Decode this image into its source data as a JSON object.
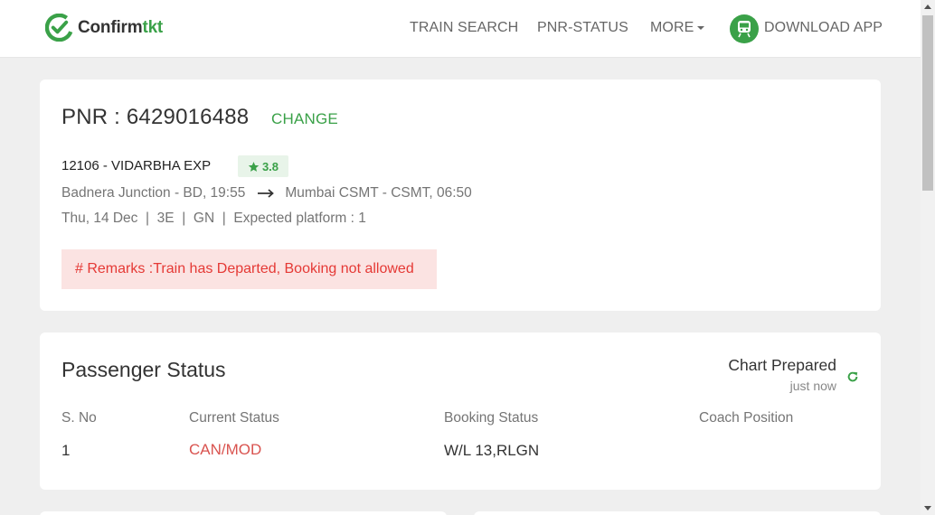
{
  "header": {
    "logo": {
      "text_part1": "Confirm",
      "text_part2": "tkt",
      "icon": "confirmtkt-logo-icon"
    },
    "nav": {
      "train_search": "TRAIN SEARCH",
      "pnr_status": "PNR-STATUS",
      "more": "MORE",
      "download_app": "DOWNLOAD APP",
      "download_icon": "train-app-icon"
    }
  },
  "pnr_card": {
    "pnr_text": "PNR : 6429016488",
    "change_label": "CHANGE",
    "train_name": "12106 - VIDARBHA EXP",
    "rating": "3.8",
    "rating_icon": "star-icon",
    "from": "Badnera Junction - BD, 19:55",
    "to": "Mumbai CSMT - CSMT, 06:50",
    "details": "Thu, 14 Dec  |  3E  |  GN  |  Expected platform : 1",
    "remarks": "# Remarks :Train has Departed, Booking not allowed"
  },
  "passenger_card": {
    "title": "Passenger Status",
    "chart_status": "Chart Prepared",
    "chart_time": "just now",
    "columns": [
      "S. No",
      "Current Status",
      "Booking Status",
      "Coach Position"
    ],
    "rows": [
      {
        "sno": "1",
        "current": "CAN/MOD",
        "booking": "W/L 13,RLGN",
        "coach": ""
      }
    ]
  },
  "colors": {
    "brand_green": "#3aa148",
    "danger_red": "#e53935",
    "remarks_bg": "#fbe3e2"
  }
}
